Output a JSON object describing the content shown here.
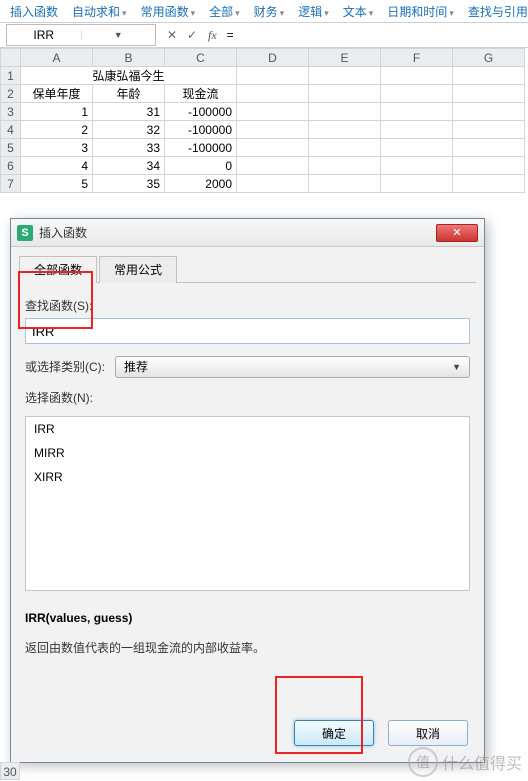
{
  "toolbar": {
    "items": [
      "插入函数",
      "自动求和",
      "常用函数",
      "全部",
      "财务",
      "逻辑",
      "文本",
      "日期和时间",
      "查找与引用"
    ]
  },
  "fbar": {
    "name": "IRR",
    "cancel": "✕",
    "confirm": "✓",
    "fx": "fx",
    "formula": "="
  },
  "grid": {
    "cols": [
      "A",
      "B",
      "C",
      "D",
      "E",
      "F",
      "G"
    ],
    "title": "弘康弘福今生",
    "headers": [
      "保单年度",
      "年龄",
      "现金流"
    ],
    "rows": [
      {
        "n": "3",
        "a": "1",
        "b": "31",
        "c": "-100000"
      },
      {
        "n": "4",
        "a": "2",
        "b": "32",
        "c": "-100000"
      },
      {
        "n": "5",
        "a": "3",
        "b": "33",
        "c": "-100000"
      },
      {
        "n": "6",
        "a": "4",
        "b": "34",
        "c": "0"
      },
      {
        "n": "7",
        "a": "5",
        "b": "35",
        "c": "2000"
      }
    ],
    "row_last": "30"
  },
  "dialog": {
    "title": "插入函数",
    "tabs": {
      "all": "全部函数",
      "common": "常用公式"
    },
    "search_label": "查找函数(S):",
    "search_value": "IRR",
    "category_label": "或选择类别(C):",
    "category_value": "推荐",
    "select_label": "选择函数(N):",
    "list": [
      "IRR",
      "MIRR",
      "XIRR"
    ],
    "signature": "IRR(values, guess)",
    "description": "返回由数值代表的一组现金流的内部收益率。",
    "ok": "确定",
    "cancel": "取消"
  },
  "watermark": {
    "icon": "值",
    "text": "什么值得买"
  }
}
